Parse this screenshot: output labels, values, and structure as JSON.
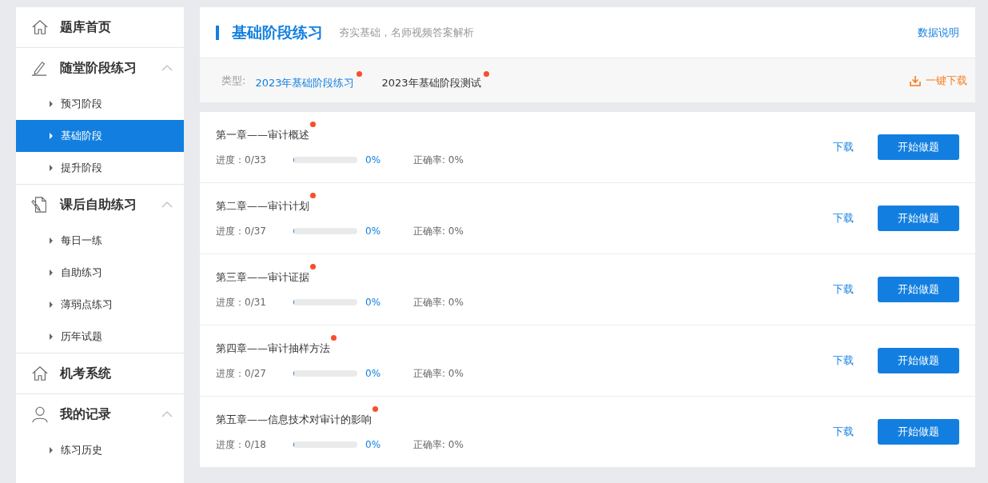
{
  "sidebar": {
    "sections": [
      {
        "label": "题库首页",
        "kind": "home"
      },
      {
        "label": "随堂阶段练习",
        "kind": "pencil",
        "expanded": true,
        "children": [
          {
            "label": "预习阶段",
            "selected": false
          },
          {
            "label": "基础阶段",
            "selected": true
          },
          {
            "label": "提升阶段",
            "selected": false
          }
        ]
      },
      {
        "label": "课后自助练习",
        "kind": "document",
        "expanded": true,
        "children": [
          {
            "label": "每日一练",
            "selected": false
          },
          {
            "label": "自助练习",
            "selected": false
          },
          {
            "label": "薄弱点练习",
            "selected": false
          },
          {
            "label": "历年试题",
            "selected": false
          }
        ]
      },
      {
        "label": "机考系统",
        "kind": "home"
      },
      {
        "label": "我的记录",
        "kind": "user",
        "expanded": true,
        "children": [
          {
            "label": "练习历史",
            "selected": false
          }
        ]
      }
    ]
  },
  "header": {
    "title": "基础阶段练习",
    "subtitle": "夯实基础，名师视频答案解析",
    "help_link": "数据说明"
  },
  "type_filter": {
    "label": "类型:",
    "tabs": [
      {
        "label": "2023年基础阶段练习",
        "selected": true,
        "new": true
      },
      {
        "label": "2023年基础阶段测试",
        "selected": false,
        "new": true
      }
    ],
    "download_all": "一键下载"
  },
  "chapters": [
    {
      "title": "第一章——审计概述",
      "new": true,
      "progress": "进度：0/33",
      "level": 0,
      "percent": "0%",
      "accuracy": "正确率: 0%",
      "download": "下载",
      "start": "开始做题"
    },
    {
      "title": "第二章——审计计划",
      "new": true,
      "progress": "进度：0/37",
      "level": 0,
      "percent": "0%",
      "accuracy": "正确率: 0%",
      "download": "下载",
      "start": "开始做题"
    },
    {
      "title": "第三章——审计证据",
      "new": true,
      "progress": "进度：0/31",
      "level": 0,
      "percent": "0%",
      "accuracy": "正确率: 0%",
      "download": "下载",
      "start": "开始做题"
    },
    {
      "title": "第四章——审计抽样方法",
      "new": true,
      "progress": "进度：0/27",
      "level": 0,
      "percent": "0%",
      "accuracy": "正确率: 0%",
      "download": "下载",
      "start": "开始做题"
    },
    {
      "title": "第五章——信息技术对审计的影响",
      "new": true,
      "progress": "进度：0/18",
      "level": 0,
      "percent": "0%",
      "accuracy": "正确率: 0%",
      "download": "下载",
      "start": "开始做题"
    }
  ]
}
